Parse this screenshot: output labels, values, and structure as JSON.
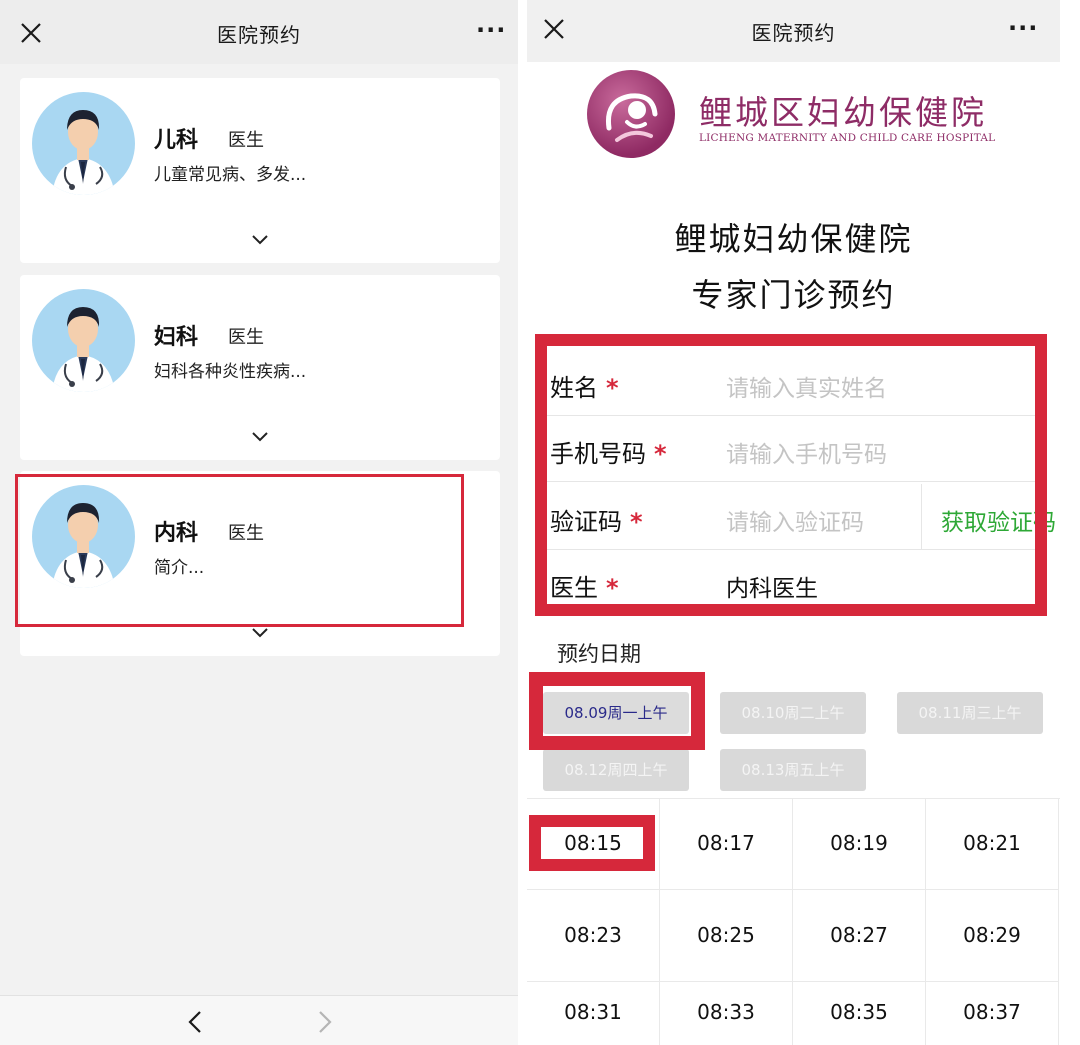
{
  "left": {
    "title": "医院预约",
    "more": "···",
    "doctors": [
      {
        "dept": "儿科",
        "role": "医生",
        "intro": "儿童常见病、多发..."
      },
      {
        "dept": "妇科",
        "role": "医生",
        "intro": "妇科各种炎性疾病..."
      },
      {
        "dept": "内科",
        "role": "医生",
        "intro": "简介..."
      }
    ]
  },
  "right": {
    "title": "医院预约",
    "more": "···",
    "hospital_name": "鲤城区妇幼保健院",
    "hospital_name_en": "LICHENG MATERNITY AND CHILD CARE HOSPITAL",
    "heading_line1": "鲤城妇幼保健院",
    "heading_line2": "专家门诊预约",
    "form": {
      "name_label": "姓名",
      "name_placeholder": "请输入真实姓名",
      "phone_label": "手机号码",
      "phone_placeholder": "请输入手机号码",
      "code_label": "验证码",
      "code_placeholder": "请输入验证码",
      "get_code": "获取验证码",
      "doctor_label": "医生",
      "doctor_value": "内科医生",
      "required_mark": "*"
    },
    "date_label": "预约日期",
    "dates": [
      "08.09周一上午",
      "08.10周二上午",
      "08.11周三上午",
      "08.12周四上午",
      "08.13周五上午"
    ],
    "times": [
      "08:15",
      "08:17",
      "08:19",
      "08:21",
      "08:23",
      "08:25",
      "08:27",
      "08:29",
      "08:31",
      "08:33",
      "08:35",
      "08:37"
    ]
  },
  "colors": {
    "highlight": "#d6283b",
    "brand": "#8e2c66",
    "link_green": "#2ea836"
  }
}
